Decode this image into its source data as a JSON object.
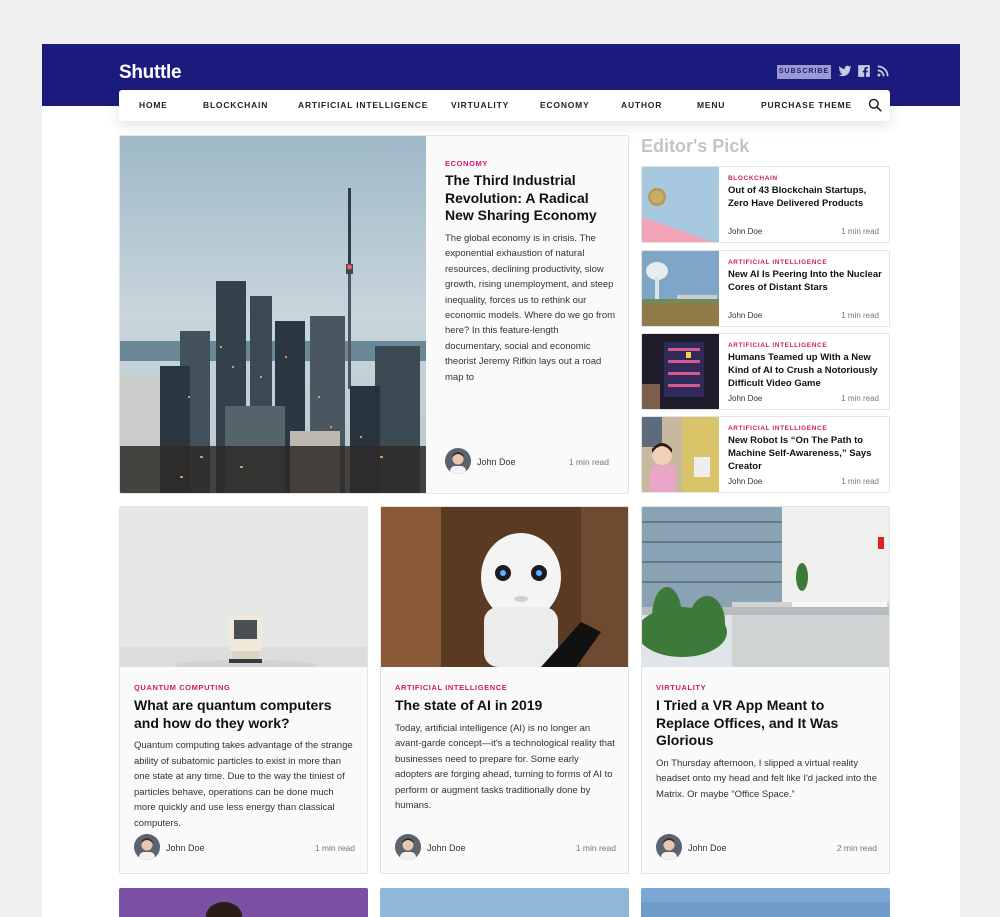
{
  "site": {
    "logo": "Shuttle",
    "subscribe_label": "SUBSCRIBE",
    "social_icons": [
      "twitter-icon",
      "facebook-icon",
      "rss-icon"
    ],
    "brand_color": "#1b1b7e",
    "accent_color": "#d1196b"
  },
  "nav": {
    "items": [
      "HOME",
      "BLOCKCHAIN",
      "ARTIFICIAL INTELLIGENCE",
      "VIRTUALITY",
      "ECONOMY",
      "AUTHOR",
      "MENU",
      "PURCHASE THEME"
    ],
    "search_icon": "search-icon"
  },
  "featured": {
    "category": "ECONOMY",
    "title": "The Third Industrial Revolution: A Radical New Sharing Economy",
    "excerpt": "The global economy is in crisis. The exponential exhaustion of natural resources, declining productivity, slow growth, rising unemployment, and steep inequality, forces us to rethink our economic models. Where do we go from here? In this feature-length documentary, social and economic theorist Jeremy Rifkin lays out a road map to",
    "author": "John Doe",
    "read_time": "1 min read"
  },
  "editors_pick": {
    "heading": "Editor's Pick",
    "items": [
      {
        "category": "BLOCKCHAIN",
        "title": "Out of 43 Blockchain Startups, Zero Have Delivered Products",
        "author": "John Doe",
        "read_time": "1 min read"
      },
      {
        "category": "ARTIFICIAL INTELLIGENCE",
        "title": "New AI Is Peering Into the Nuclear Cores of Distant Stars",
        "author": "John Doe",
        "read_time": "1 min read"
      },
      {
        "category": "ARTIFICIAL INTELLIGENCE",
        "title": "Humans Teamed up With a New Kind of AI to Crush a Notoriously Difficult Video Game",
        "author": "John Doe",
        "read_time": "1 min read"
      },
      {
        "category": "ARTIFICIAL INTELLIGENCE",
        "title": "New Robot Is “On The Path to Machine Self-Awareness,” Says Creator",
        "author": "John Doe",
        "read_time": "1 min read"
      }
    ]
  },
  "posts": [
    {
      "category": "QUANTUM COMPUTING",
      "title": "What are quantum computers and how do they work?",
      "excerpt": "Quantum computing takes advantage of the strange ability of subatomic particles to exist in more than one state at any time. Due to the way the tiniest of particles behave, operations can be done much more quickly and use less energy than classical computers.",
      "author": "John Doe",
      "read_time": "1 min read"
    },
    {
      "category": "ARTIFICIAL INTELLIGENCE",
      "title": "The state of AI in 2019",
      "excerpt": "Today, artificial intelligence (AI) is no longer an avant-garde concept—it's a technological reality that businesses need to prepare for. Some early adopters are forging ahead, turning to forms of AI to perform or augment tasks traditionally done by humans.",
      "author": "John Doe",
      "read_time": "1 min read"
    },
    {
      "category": "VIRTUALITY",
      "title": "I Tried a VR App Meant to Replace Offices, and It Was Glorious",
      "excerpt": "On Thursday afternoon, I slipped a virtual reality headset onto my head and felt like I'd jacked into the Matrix. Or maybe “Office Space.”",
      "author": "John Doe",
      "read_time": "2 min read"
    }
  ]
}
